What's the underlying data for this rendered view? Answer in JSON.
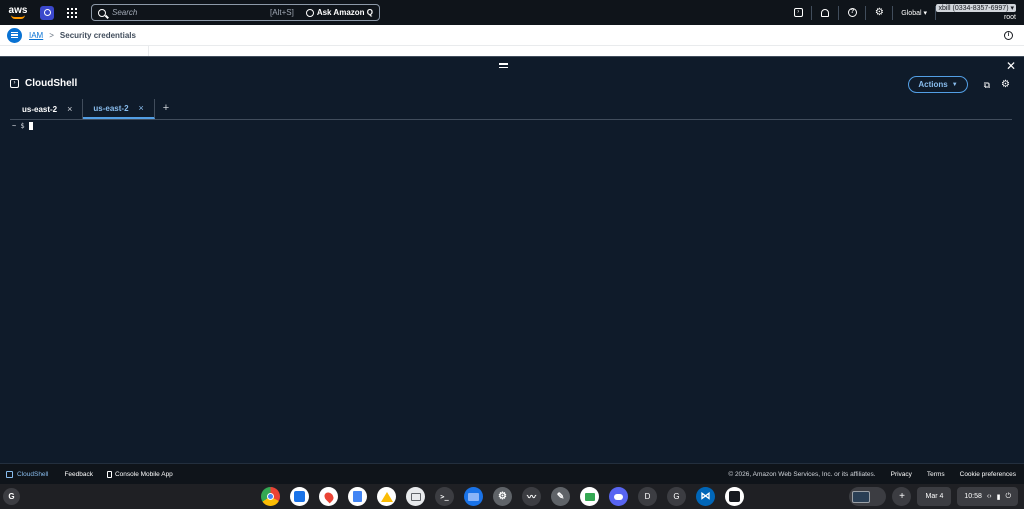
{
  "topnav": {
    "logo_text": "aws",
    "search_placeholder": "Search",
    "search_shortcut": "[Alt+S]",
    "ask_q_label": "Ask Amazon Q",
    "region_label": "Global ▾",
    "account_label": "xbill (0334-8357-6997) ▾",
    "user_label": "root"
  },
  "breadcrumb": {
    "service": "IAM",
    "separator": ">",
    "current": "Security credentials"
  },
  "cloudshell": {
    "title": "CloudShell",
    "actions_label": "Actions",
    "tabs": [
      {
        "label": "us-east-2",
        "active": false
      },
      {
        "label": "us-east-2",
        "active": true
      }
    ],
    "add_tab": "+",
    "close_tab": "×",
    "prompt": "~ $"
  },
  "footer": {
    "cloudshell": "CloudShell",
    "feedback": "Feedback",
    "mobile_app": "Console Mobile App",
    "copyright": "© 2026, Amazon Web Services, Inc. or its affiliates.",
    "privacy": "Privacy",
    "terms": "Terms",
    "cookies": "Cookie preferences"
  },
  "shelf": {
    "launcher": "G",
    "apps": [
      {
        "name": "chrome",
        "color": "#ea4335"
      },
      {
        "name": "calendar",
        "color": "#1a73e8"
      },
      {
        "name": "maps",
        "color": "#ffffff"
      },
      {
        "name": "docs",
        "color": "#4285f4"
      },
      {
        "name": "drive",
        "color": "#ffffff"
      },
      {
        "name": "screen-capture",
        "color": "#e8eaed"
      },
      {
        "name": "terminal",
        "color": "#3c3d42"
      },
      {
        "name": "files",
        "color": "#1a73e8"
      },
      {
        "name": "settings",
        "color": "#5f6368"
      },
      {
        "name": "stocks",
        "color": "#3c3d42"
      },
      {
        "name": "tools",
        "color": "#5f6368"
      },
      {
        "name": "meet",
        "color": "#ffffff"
      },
      {
        "name": "discord",
        "color": "#5865f2"
      },
      {
        "name": "d-app",
        "letter": "D",
        "color": "#3c3d42"
      },
      {
        "name": "g-app",
        "letter": "G",
        "color": "#3c3d42"
      },
      {
        "name": "vscode",
        "color": "#0066b8"
      },
      {
        "name": "a-app",
        "color": "#ffffff"
      }
    ],
    "date": "Mar 4",
    "time": "10:58"
  }
}
